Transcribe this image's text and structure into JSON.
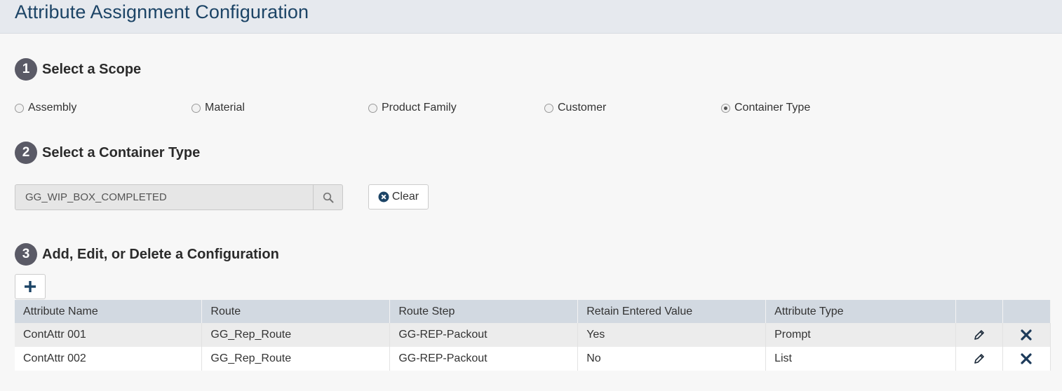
{
  "header": {
    "title": "Attribute Assignment Configuration"
  },
  "steps": [
    {
      "number": "1",
      "title": "Select a Scope"
    },
    {
      "number": "2",
      "title": "Select a Container Type"
    },
    {
      "number": "3",
      "title": "Add, Edit, or Delete a Configuration"
    }
  ],
  "scope_options": [
    {
      "label": "Assembly",
      "checked": false
    },
    {
      "label": "Material",
      "checked": false
    },
    {
      "label": "Product Family",
      "checked": false
    },
    {
      "label": "Customer",
      "checked": false
    },
    {
      "label": "Container Type",
      "checked": true
    }
  ],
  "container_search": {
    "value": "GG_WIP_BOX_COMPLETED",
    "icon": "search-icon"
  },
  "clear_button": {
    "label": "Clear",
    "icon": "times-circle-icon"
  },
  "add_button": {
    "icon": "plus-icon"
  },
  "table": {
    "columns": [
      "Attribute Name",
      "Route",
      "Route Step",
      "Retain Entered Value",
      "Attribute Type"
    ],
    "rows": [
      {
        "name": "ContAttr 001",
        "route": "GG_Rep_Route",
        "step": "GG-REP-Packout",
        "retain": "Yes",
        "type": "Prompt"
      },
      {
        "name": "ContAttr 002",
        "route": "GG_Rep_Route",
        "step": "GG-REP-Packout",
        "retain": "No",
        "type": "List"
      }
    ]
  },
  "colors": {
    "header_bg": "#e6e9ee",
    "title": "#1c4466",
    "accent": "#1c4466",
    "table_header": "#d2d9e1"
  }
}
